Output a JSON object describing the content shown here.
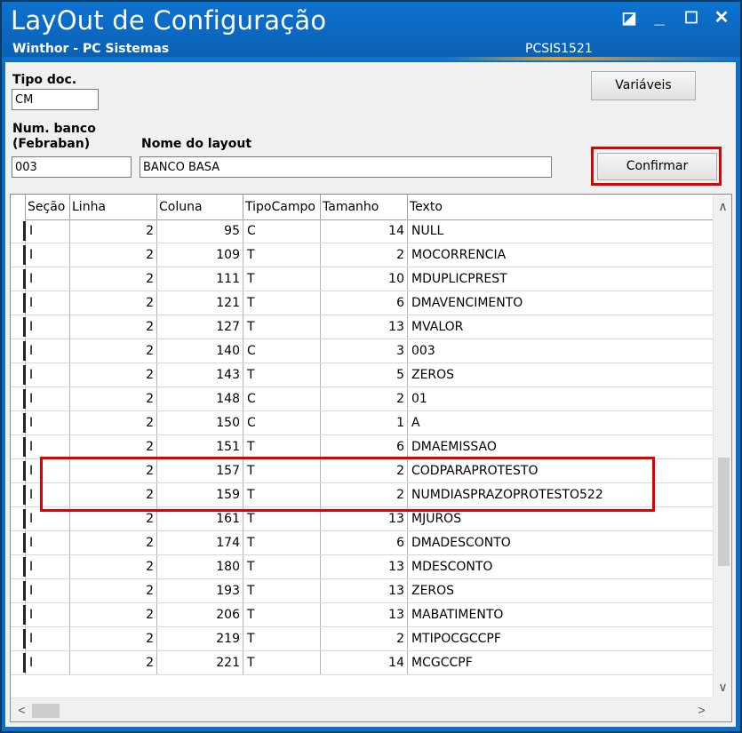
{
  "window": {
    "title": "LayOut de Configuração",
    "subtitle": "Winthor - PC Sistemas",
    "code": "PCSIS1521",
    "controls": {
      "restore": "◪",
      "minimize": "_",
      "maximize": "☐",
      "close": "✕"
    }
  },
  "form": {
    "tipo_doc_label": "Tipo doc.",
    "tipo_doc_value": "CM",
    "num_banco_label_1": "Num. banco",
    "num_banco_label_2": "(Febraban)",
    "num_banco_value": "003",
    "nome_layout_label": "Nome do layout",
    "nome_layout_value": "BANCO BASA",
    "variaveis_button": "Variáveis",
    "confirmar_button": "Confirmar"
  },
  "grid": {
    "columns": [
      "Seção",
      "Linha",
      "Coluna",
      "TipoCampo",
      "Tamanho",
      "Texto"
    ],
    "rows": [
      [
        "I",
        "2",
        "95",
        "C",
        "14",
        "NULL"
      ],
      [
        "I",
        "2",
        "109",
        "T",
        "2",
        "MOCORRENCIA"
      ],
      [
        "I",
        "2",
        "111",
        "T",
        "10",
        "MDUPLICPREST"
      ],
      [
        "I",
        "2",
        "121",
        "T",
        "6",
        "DMAVENCIMENTO"
      ],
      [
        "I",
        "2",
        "127",
        "T",
        "13",
        "MVALOR"
      ],
      [
        "I",
        "2",
        "140",
        "C",
        "3",
        "003"
      ],
      [
        "I",
        "2",
        "143",
        "T",
        "5",
        "ZEROS"
      ],
      [
        "I",
        "2",
        "148",
        "C",
        "2",
        "01"
      ],
      [
        "I",
        "2",
        "150",
        "C",
        "1",
        "A"
      ],
      [
        "I",
        "2",
        "151",
        "T",
        "6",
        "DMAEMISSAO"
      ],
      [
        "I",
        "2",
        "157",
        "T",
        "2",
        "CODPARAPROTESTO"
      ],
      [
        "I",
        "2",
        "159",
        "T",
        "2",
        "NUMDIASPRAZOPROTESTO522"
      ],
      [
        "I",
        "2",
        "161",
        "T",
        "13",
        "MJUROS"
      ],
      [
        "I",
        "2",
        "174",
        "T",
        "6",
        "DMADESCONTO"
      ],
      [
        "I",
        "2",
        "180",
        "T",
        "13",
        "MDESCONTO"
      ],
      [
        "I",
        "2",
        "193",
        "T",
        "13",
        "ZEROS"
      ],
      [
        "I",
        "2",
        "206",
        "T",
        "13",
        "MABATIMENTO"
      ],
      [
        "I",
        "2",
        "219",
        "T",
        "2",
        "MTIPOCGCCPF"
      ],
      [
        "I",
        "2",
        "221",
        "T",
        "14",
        "MCGCCPF"
      ]
    ],
    "scroll_arrows": {
      "up": "∧",
      "down": "∨",
      "left": "<",
      "right": ">"
    }
  },
  "colors": {
    "titlebar": "#0d72cf",
    "highlight": "#e00000"
  }
}
